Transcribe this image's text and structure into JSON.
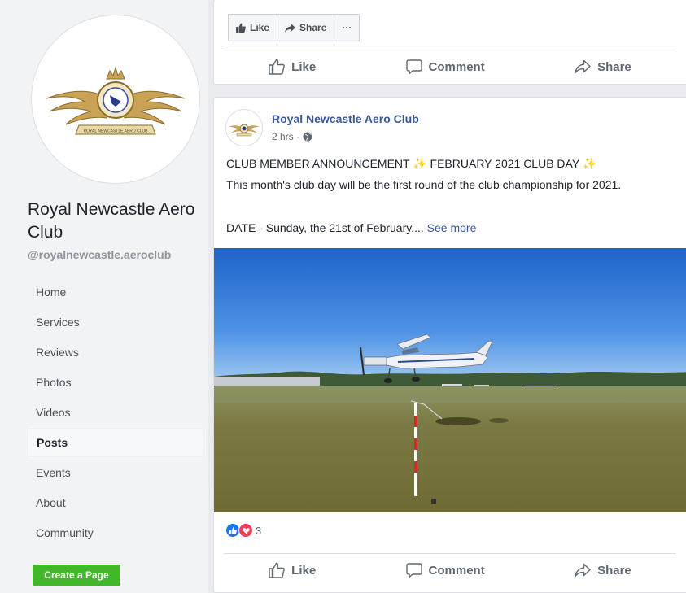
{
  "sidebar": {
    "page_name": "Royal Newcastle Aero Club",
    "handle": "@royalnewcastle.aeroclub",
    "nav": [
      {
        "label": "Home",
        "active": false
      },
      {
        "label": "Services",
        "active": false
      },
      {
        "label": "Reviews",
        "active": false
      },
      {
        "label": "Photos",
        "active": false
      },
      {
        "label": "Videos",
        "active": false
      },
      {
        "label": "Posts",
        "active": true
      },
      {
        "label": "Events",
        "active": false
      },
      {
        "label": "About",
        "active": false
      },
      {
        "label": "Community",
        "active": false
      }
    ],
    "create_page_label": "Create a Page",
    "logo_text": "ROYAL NEWCASTLE AERO CLUB"
  },
  "top_card": {
    "mini_buttons": {
      "like": "Like",
      "share": "Share",
      "more": "···"
    },
    "actions": {
      "like": "Like",
      "comment": "Comment",
      "share": "Share"
    }
  },
  "post": {
    "author": "Royal Newcastle Aero Club",
    "time": "2 hrs ·",
    "line1": "CLUB MEMBER ANNOUNCEMENT ✨ FEBRUARY 2021 CLUB DAY ✨",
    "line2": "This month's club day will be the first round of the club championship for 2021.",
    "line3": "DATE - Sunday, the 21st of February.... ",
    "see_more": "See more",
    "reaction_count": "3",
    "actions": {
      "like": "Like",
      "comment": "Comment",
      "share": "Share"
    }
  },
  "colors": {
    "link": "#385898",
    "create_button": "#42b72a",
    "like_blue": "#1877f2",
    "love_red": "#f33e58"
  },
  "icons": [
    "thumbs-up-icon",
    "share-arrow-icon",
    "comment-icon",
    "globe-icon",
    "like-reaction-icon",
    "love-reaction-icon",
    "more-icon"
  ]
}
